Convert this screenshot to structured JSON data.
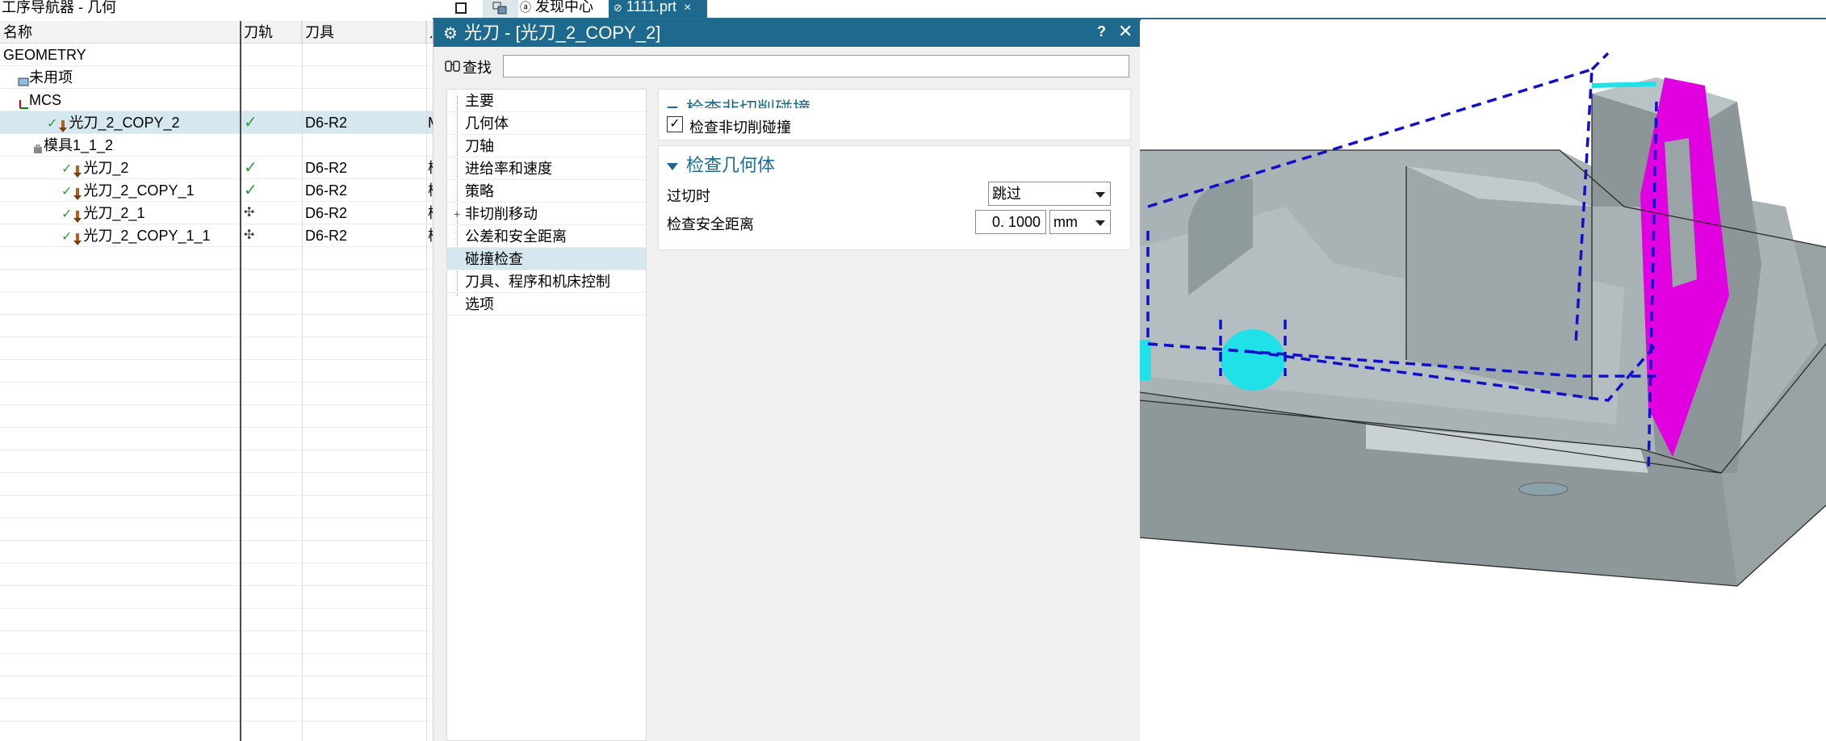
{
  "navigator": {
    "title": "工序导航器 - 几何",
    "columns": [
      "名称",
      "刀轨",
      "刀具",
      "几"
    ],
    "rows": [
      {
        "name": "GEOMETRY",
        "path": "",
        "tool": "",
        "extra": "",
        "indent": 0,
        "icon": ""
      },
      {
        "name": "未用项",
        "path": "",
        "tool": "",
        "extra": "",
        "indent": 1,
        "icon": "folder-icon"
      },
      {
        "name": "MCS",
        "path": "",
        "tool": "",
        "extra": "",
        "indent": 1,
        "icon": "mcs-icon"
      },
      {
        "name": "光刀_2_COPY_2",
        "path": "✓",
        "tool": "D6-R2",
        "extra": "M",
        "indent": 3,
        "icon": "operation-icon",
        "selected": true
      },
      {
        "name": "模具1_1_2",
        "path": "",
        "tool": "",
        "extra": "",
        "indent": 2,
        "icon": "workpiece-icon"
      },
      {
        "name": "光刀_2",
        "path": "✓",
        "tool": "D6-R2",
        "extra": "模",
        "indent": 4,
        "icon": "operation-icon"
      },
      {
        "name": "光刀_2_COPY_1",
        "path": "✓",
        "tool": "D6-R2",
        "extra": "模",
        "indent": 4,
        "icon": "operation-icon"
      },
      {
        "name": "光刀_2_1",
        "path": "✣",
        "tool": "D6-R2",
        "extra": "模",
        "indent": 4,
        "icon": "operation-icon"
      },
      {
        "name": "光刀_2_COPY_1_1",
        "path": "✣",
        "tool": "D6-R2",
        "extra": "模",
        "indent": 4,
        "icon": "operation-icon"
      }
    ]
  },
  "tabs": [
    {
      "label": "",
      "icon": "window-icon"
    },
    {
      "label": "",
      "icon": "navigator-icon"
    },
    {
      "label": "发现中心",
      "icon": "discover-icon"
    },
    {
      "label": "1111.prt",
      "icon": "part-icon",
      "close": "×"
    }
  ],
  "dialog": {
    "title": "光刀 - [光刀_2_COPY_2]",
    "help": "?",
    "close": "✕",
    "find_label": "查找",
    "find_value": "",
    "menu": [
      {
        "label": "主要"
      },
      {
        "label": "几何体"
      },
      {
        "label": "刀轴"
      },
      {
        "label": "进给率和速度"
      },
      {
        "label": "策略"
      },
      {
        "label": "非切削移动",
        "expand": "+"
      },
      {
        "label": "公差和安全距离"
      },
      {
        "label": "碰撞检查",
        "selected": true
      },
      {
        "label": "刀具、程序和机床控制"
      },
      {
        "label": "选项"
      }
    ],
    "group1": {
      "title": "检查非切削碰撞",
      "checkbox_label": "检查非切削碰撞",
      "checked": true
    },
    "group2": {
      "title": "检查几何体",
      "overcut_label": "过切时",
      "overcut_value": "跳过",
      "clearance_label": "检查安全距离",
      "clearance_value": "0. 1000",
      "unit_value": "mm"
    }
  },
  "colors": {
    "title_bar": "#1e6a8e",
    "selection": "#d6e8ef",
    "model": "#9aa4a6",
    "toolpath": "#1010cc",
    "highlight_face": "#e000e0",
    "cyan_face": "#20e0e8"
  }
}
